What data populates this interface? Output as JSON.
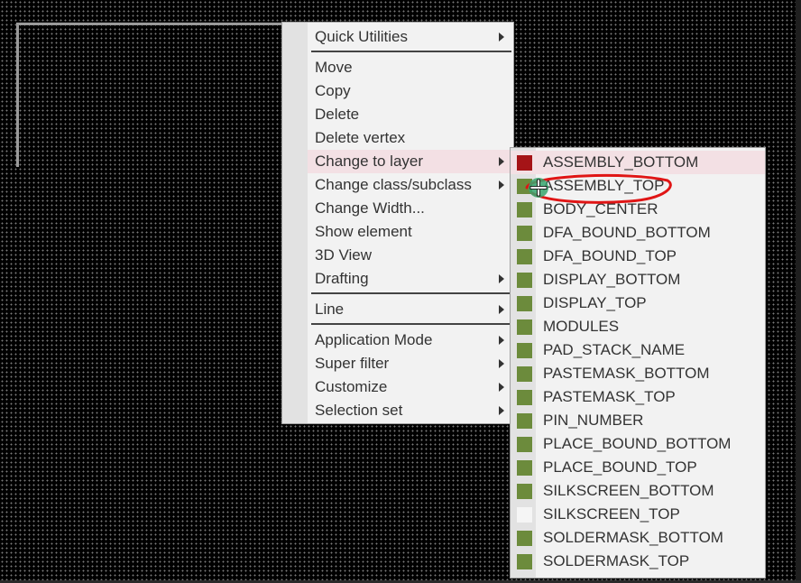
{
  "colors": {
    "assembly_bottom": "#a51417",
    "green_layer": "#6c8b3c",
    "silkscreen_top": "#f5f5f5",
    "annotation_stroke": "#e01515",
    "cursor_glow": "#37a66e"
  },
  "context_menu": {
    "items": [
      {
        "label": "Quick Utilities"
      },
      {
        "label": "Move"
      },
      {
        "label": "Copy"
      },
      {
        "label": "Delete"
      },
      {
        "label": "Delete vertex"
      },
      {
        "label": "Change to layer"
      },
      {
        "label": "Change class/subclass"
      },
      {
        "label": "Change Width..."
      },
      {
        "label": "Show element"
      },
      {
        "label": "3D View"
      },
      {
        "label": "Drafting"
      },
      {
        "label": "Line"
      },
      {
        "label": "Application Mode"
      },
      {
        "label": "Super filter"
      },
      {
        "label": "Customize"
      },
      {
        "label": "Selection set"
      }
    ]
  },
  "layer_submenu": {
    "items": [
      {
        "label": "ASSEMBLY_BOTTOM",
        "swatch": "#a51417"
      },
      {
        "label": "ASSEMBLY_TOP",
        "swatch": "#6c8b3c"
      },
      {
        "label": "BODY_CENTER",
        "swatch": "#6c8b3c"
      },
      {
        "label": "DFA_BOUND_BOTTOM",
        "swatch": "#6c8b3c"
      },
      {
        "label": "DFA_BOUND_TOP",
        "swatch": "#6c8b3c"
      },
      {
        "label": "DISPLAY_BOTTOM",
        "swatch": "#6c8b3c"
      },
      {
        "label": "DISPLAY_TOP",
        "swatch": "#6c8b3c"
      },
      {
        "label": "MODULES",
        "swatch": "#6c8b3c"
      },
      {
        "label": "PAD_STACK_NAME",
        "swatch": "#6c8b3c"
      },
      {
        "label": "PASTEMASK_BOTTOM",
        "swatch": "#6c8b3c"
      },
      {
        "label": "PASTEMASK_TOP",
        "swatch": "#6c8b3c"
      },
      {
        "label": "PIN_NUMBER",
        "swatch": "#6c8b3c"
      },
      {
        "label": "PLACE_BOUND_BOTTOM",
        "swatch": "#6c8b3c"
      },
      {
        "label": "PLACE_BOUND_TOP",
        "swatch": "#6c8b3c"
      },
      {
        "label": "SILKSCREEN_BOTTOM",
        "swatch": "#6c8b3c"
      },
      {
        "label": "SILKSCREEN_TOP",
        "swatch": "#f5f5f5"
      },
      {
        "label": "SOLDERMASK_BOTTOM",
        "swatch": "#6c8b3c"
      },
      {
        "label": "SOLDERMASK_TOP",
        "swatch": "#6c8b3c"
      }
    ]
  },
  "icons": {
    "submenu_arrow": "chevron-right-icon",
    "cursor": "crosshair-cursor-icon",
    "annotation": "red-circle-annotation"
  }
}
